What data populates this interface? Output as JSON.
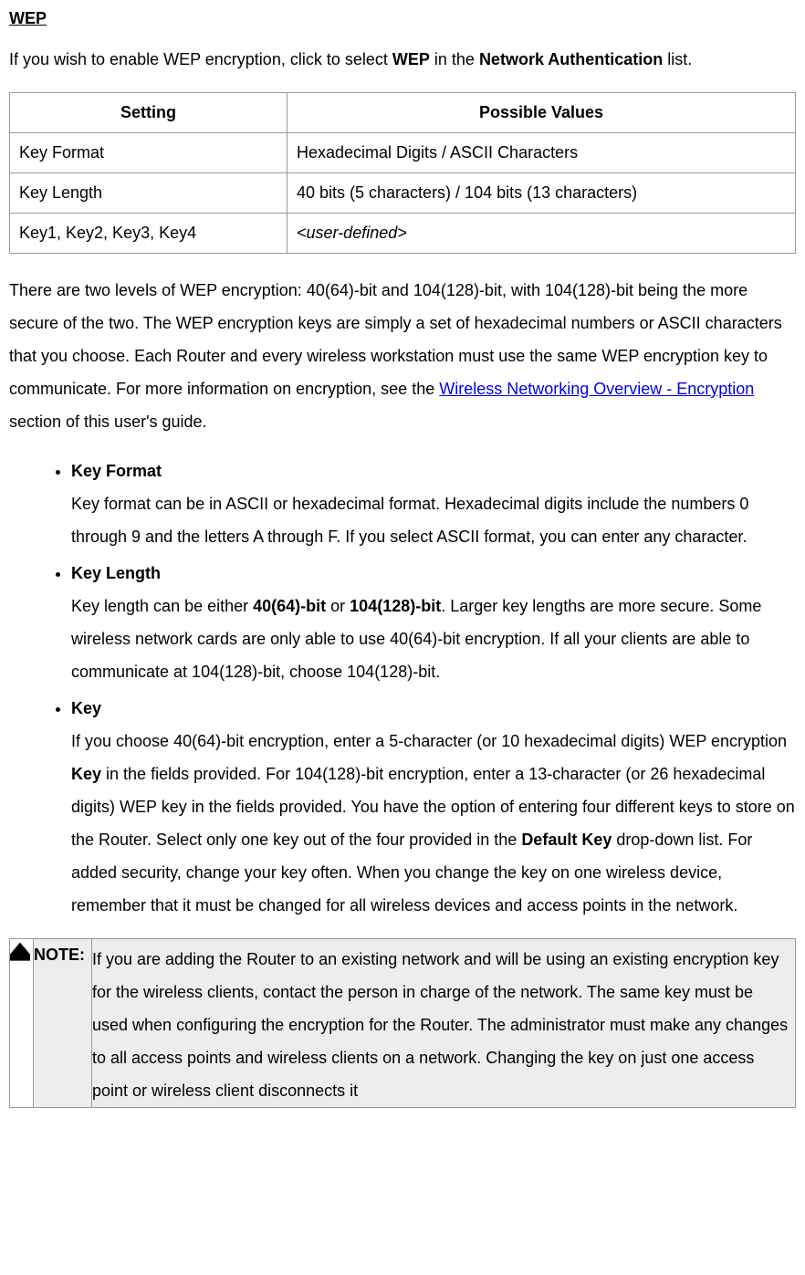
{
  "heading": "WEP",
  "intro_pre": "If you wish to enable WEP encryption, click to select ",
  "intro_bold1": "WEP",
  "intro_mid": " in the ",
  "intro_bold2": "Network Authentication",
  "intro_post": " list.",
  "table": {
    "headers": {
      "setting": "Setting",
      "values": "Possible Values"
    },
    "rows": [
      {
        "setting": "Key Format",
        "values": "Hexadecimal Digits / ASCII Characters"
      },
      {
        "setting": "Key Length",
        "values": "40 bits (5 characters) / 104 bits (13 characters)"
      },
      {
        "setting": "Key1, Key2, Key3, Key4",
        "values_italic": "<user-defined>"
      }
    ]
  },
  "para2_pre": "There are two levels of WEP encryption: 40(64)-bit and 104(128)-bit, with 104(128)-bit being the more secure of the two. The WEP encryption keys are simply a set of hexadecimal numbers or ASCII characters that you choose. Each Router and every wireless workstation must use the same WEP encryption key to communicate. For more information on encryption, see the ",
  "para2_link": "Wireless Networking Overview - Encryption",
  "para2_post": " section of this user's guide.",
  "bullets": {
    "b1": {
      "title": "Key Format",
      "body": "Key format can be in ASCII or hexadecimal format. Hexadecimal digits include the numbers 0 through 9 and the letters A through F. If you select ASCII format, you can enter any character."
    },
    "b2": {
      "title": "Key Length",
      "body_pre": "Key length can be either ",
      "body_bold1": "40(64)-bit",
      "body_mid1": " or ",
      "body_bold2": "104(128)-bit",
      "body_post": ". Larger key lengths are more secure. Some wireless network cards are only able to use 40(64)-bit encryption. If all your clients are able to communicate at 104(128)-bit, choose 104(128)-bit."
    },
    "b3": {
      "title": "Key",
      "body_pre": "If you choose 40(64)-bit encryption, enter a 5-character (or 10 hexadecimal digits) WEP encryption ",
      "body_bold1": "Key",
      "body_mid1": " in the fields provided. For 104(128)-bit encryption, enter a 13-character (or 26 hexadecimal digits) WEP key in the fields provided. You have the option of entering four different keys to store on the Router. Select only one key out of the four provided in the ",
      "body_bold2": "Default Key",
      "body_post": " drop-down list. For added security, change your key often. When you change the key on one wireless device, remember that it must be changed for all wireless devices and access points in the network."
    }
  },
  "note": {
    "label": "NOTE:",
    "body": "If you are adding the Router to an existing network and will be using an existing encryption key for the wireless clients, contact the person in charge of the network. The same key must be used when configuring the encryption for the Router. The administrator must make any changes to all access points and wireless clients on a network. Changing the key on just one access point or wireless client disconnects it"
  }
}
